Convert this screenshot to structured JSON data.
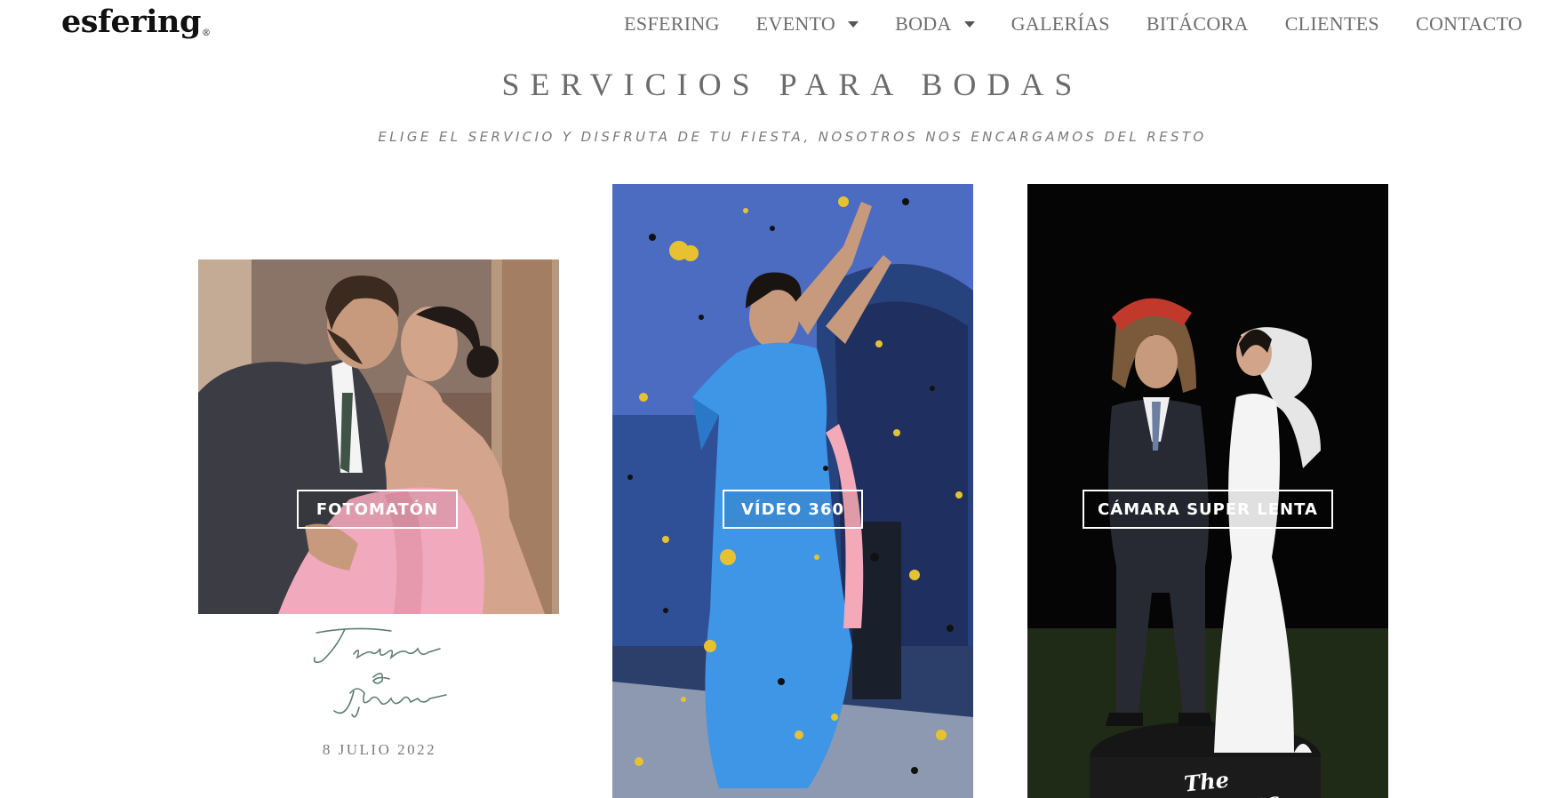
{
  "header": {
    "logo_text": "esfering",
    "logo_mark": "®",
    "nav": [
      {
        "label": "ESFERING",
        "dropdown": false
      },
      {
        "label": "EVENTO",
        "dropdown": true
      },
      {
        "label": "BODA",
        "dropdown": true
      },
      {
        "label": "GALERÍAS",
        "dropdown": false
      },
      {
        "label": "BITÁCORA",
        "dropdown": false
      },
      {
        "label": "CLIENTES",
        "dropdown": false
      },
      {
        "label": "CONTACTO",
        "dropdown": false
      }
    ]
  },
  "main": {
    "title": "SERVICIOS PARA BODAS",
    "subtitle": "ELIGE EL SERVICIO Y DISFRUTA DE TU FIESTA, NOSOTROS NOS ENCARGAMOS DEL RESTO",
    "cards": [
      {
        "label": "FOTOMATÓN",
        "photo": "couple-kissing-photo"
      },
      {
        "label": "VÍDEO 360",
        "photo": "woman-dancing-confetti-photo"
      },
      {
        "label": "CÁMARA SUPER LENTA",
        "photo": "couple-costumes-night-photo"
      }
    ],
    "signature": {
      "names": "Teresa e Ignacio",
      "date": "8 JULIO 2022"
    },
    "photo_watermark": "The Lorenzanos"
  },
  "colors": {
    "nav_text": "#6d6d6d",
    "title_text": "#6b6b6b",
    "signature_green": "#5f7d72"
  }
}
